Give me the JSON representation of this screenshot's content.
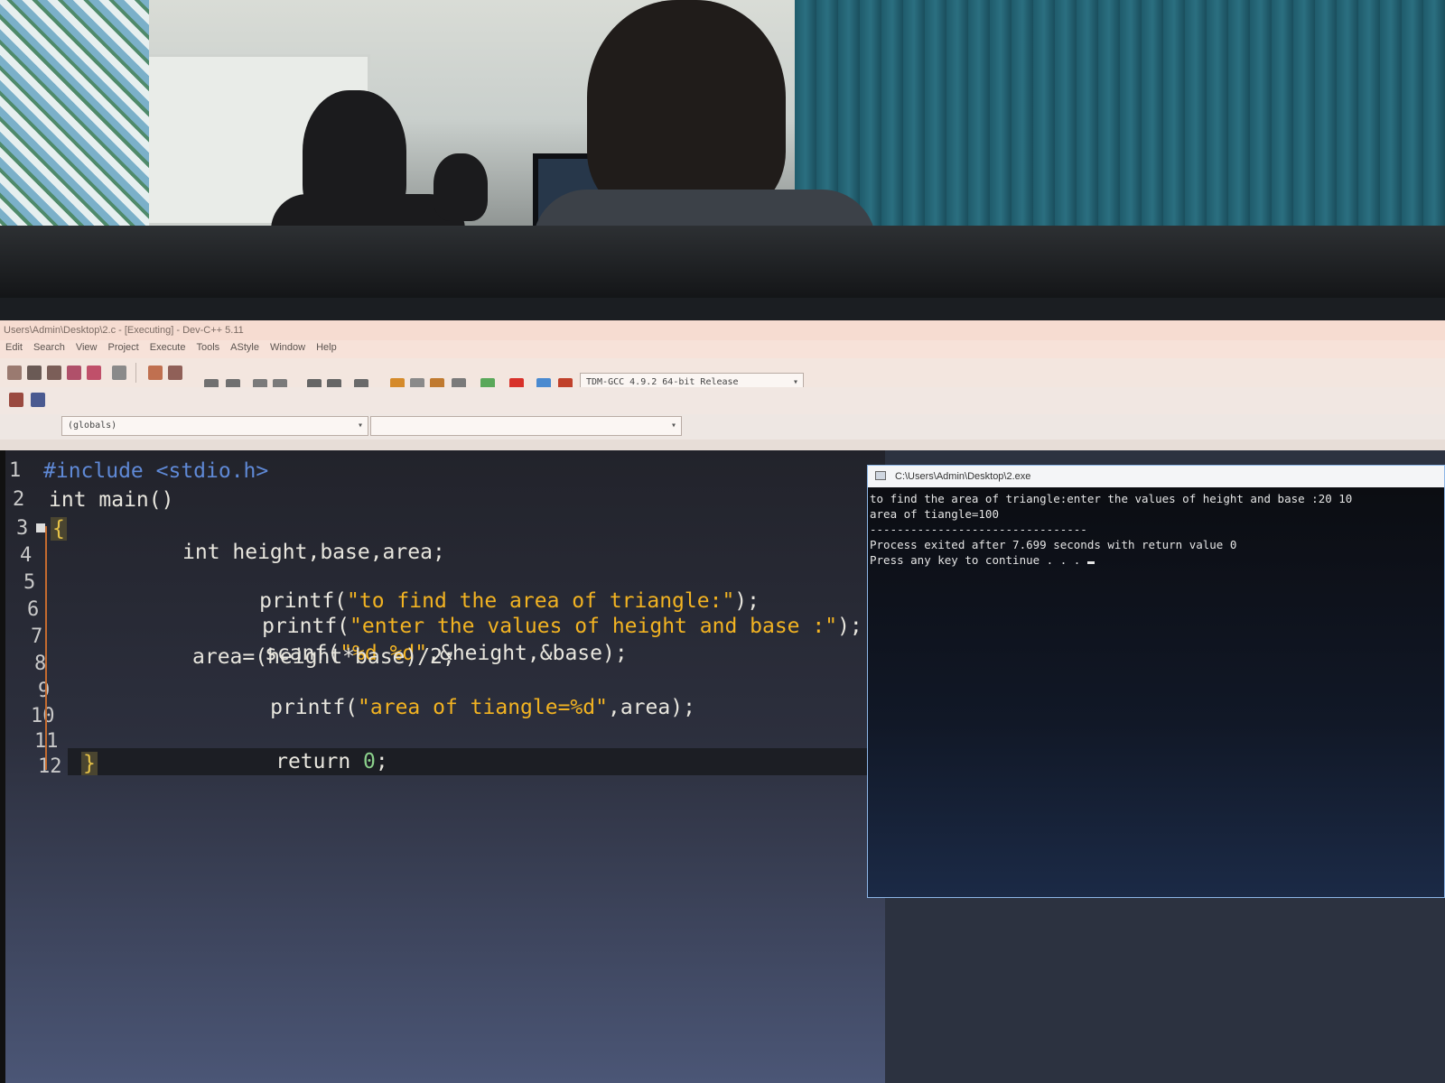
{
  "window": {
    "title": "Users\\Admin\\Desktop\\2.c - [Executing] - Dev-C++ 5.11"
  },
  "menu": [
    "Edit",
    "Search",
    "View",
    "Project",
    "Execute",
    "Tools",
    "AStyle",
    "Window",
    "Help"
  ],
  "toolbar": {
    "compiler_select": "TDM-GCC 4.9.2 64-bit Release",
    "scope_select": "(globals)",
    "member_select": ""
  },
  "editor": {
    "line_numbers": [
      "1",
      "2",
      "3",
      "4",
      "5",
      "6",
      "7",
      "8",
      "9",
      "10",
      "11",
      "12"
    ],
    "lines": {
      "l1": "#include <stdio.h>",
      "l2": "int main()",
      "l3": "{",
      "l4": "int height,base,area;",
      "l5_fn": "printf(",
      "l5_str": "\"to find the area of triangle:\"",
      "l5_end": ");",
      "l6_fn": "printf(",
      "l6_str": "\"enter the values of height and base :\"",
      "l6_end": ");",
      "l7_fn": "scanf(",
      "l7_str": "\"%d %d\"",
      "l7_end": ",&height,&base);",
      "l8": "area=(height*base)/2;",
      "l9_fn": "printf(",
      "l9_str": "\"area of tiangle=%d\"",
      "l9_end": ",area);",
      "l11_kw": "return ",
      "l11_num": "0",
      "l11_end": ";",
      "l12": "}"
    }
  },
  "console": {
    "title": "C:\\Users\\Admin\\Desktop\\2.exe",
    "lines": [
      "to find the area of triangle:enter the values of height and base :20 10",
      "area of tiangle=100",
      "--------------------------------",
      "Process exited after 7.699 seconds with return value 0",
      "Press any key to continue . . . "
    ]
  }
}
